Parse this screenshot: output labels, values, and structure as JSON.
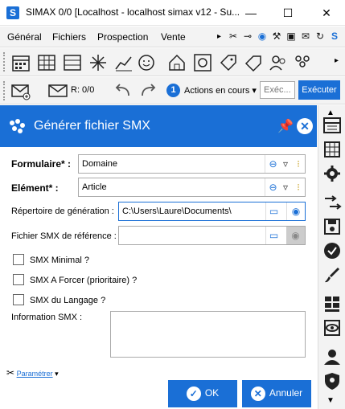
{
  "window": {
    "app_icon": "S",
    "title": "SIMAX 0/0 [Localhost - localhost simax v12 - Su...",
    "min": "—",
    "max": "☐",
    "close": "✕"
  },
  "menu": {
    "items": [
      "Général",
      "Fichiers",
      "Prospection",
      "Vente"
    ],
    "more": "▸"
  },
  "toolbar2": {
    "r_label": "R: 0/0",
    "actions_count": "1",
    "actions_label": "Actions en cours",
    "exec_placeholder": "Exéc...",
    "exec_button": "Exécuter"
  },
  "dialog": {
    "title": "Générer fichier SMX",
    "fields": {
      "formulaire_label": "Formulaire* :",
      "formulaire_value": "Domaine",
      "element_label": "Elément* :",
      "element_value": "Article",
      "repertoire_label": "Répertoire de génération :",
      "repertoire_value": "C:\\Users\\Laure\\Documents\\",
      "reference_label": "Fichier SMX de référence :",
      "reference_value": ""
    },
    "checkboxes": [
      "SMX Minimal ?",
      "SMX A Forcer (prioritaire) ?",
      "SMX du Langage ?"
    ],
    "info_label": "Information SMX :",
    "param_label": "Paramétrer",
    "ok_label": "OK",
    "cancel_label": "Annuler"
  },
  "colors": {
    "accent": "#1a6fd6"
  }
}
